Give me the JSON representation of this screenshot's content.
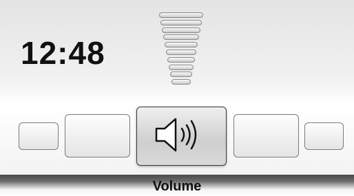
{
  "status": {
    "clock": "12:48"
  },
  "volume": {
    "levels": 10,
    "filled": 10
  },
  "carousel": {
    "items": [
      {
        "id": "far-left",
        "icon": ""
      },
      {
        "id": "left",
        "icon": ""
      },
      {
        "id": "volume",
        "icon": "speaker-volume-icon",
        "selected": true
      },
      {
        "id": "right",
        "icon": ""
      },
      {
        "id": "far-right",
        "icon": ""
      }
    ]
  },
  "footer": {
    "label": "Volume"
  }
}
